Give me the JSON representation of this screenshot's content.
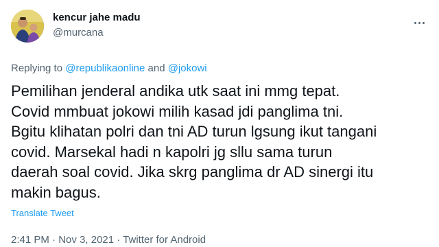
{
  "author": {
    "display_name": "kencur jahe madu",
    "handle": "@murcana"
  },
  "replying_to": {
    "prefix": "Replying to",
    "users": [
      "@republikaonline",
      "@jokowi"
    ],
    "conjunction": "and"
  },
  "tweet": {
    "lines": [
      "Pemilihan jenderal andika utk saat ini mmg tepat.",
      "Covid mmbuat jokowi milih kasad jdi panglima tni.",
      "Bgitu klihatan polri dan tni AD turun lgsung ikut tangani",
      "covid. Marsekal hadi n kapolri jg sllu sama turun",
      "daerah soal covid. Jika skrg panglima dr AD sinergi itu",
      "makin bagus."
    ],
    "translate_label": "Translate Tweet"
  },
  "meta": {
    "time": "2:41 PM",
    "separator": " · ",
    "date": "Nov 3, 2021",
    "source": "Twitter for Android"
  },
  "colors": {
    "link": "#1d9bf0",
    "secondary_text": "#536471",
    "primary_text": "#0f1419"
  },
  "icons": {
    "more": "more-horizontal-icon"
  }
}
